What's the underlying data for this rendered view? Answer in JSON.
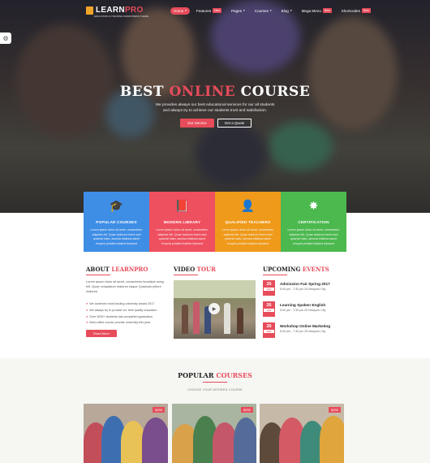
{
  "brand": {
    "name_a": "LEARN",
    "name_b": "PRO",
    "tagline": "EDUCATION & TRAINING WORDPRESS THEME"
  },
  "nav": {
    "items": [
      {
        "label": "Home",
        "badge": "",
        "active": true
      },
      {
        "label": "Features",
        "badge": "New",
        "active": false
      },
      {
        "label": "Pages",
        "badge": "",
        "active": false
      },
      {
        "label": "Courses",
        "badge": "",
        "active": false
      },
      {
        "label": "Blog",
        "badge": "",
        "active": false
      },
      {
        "label": "Mega Menu",
        "badge": "New",
        "active": false
      },
      {
        "label": "Shortcodes",
        "badge": "New",
        "active": false
      }
    ]
  },
  "hero": {
    "title_a": "BEST ",
    "title_b": "ONLINE",
    "title_c": " COURSE",
    "subtitle": "We provides always our best educational services for our all students and always try to achieve our students trust and satisfaction.",
    "btn_primary": "Our Service",
    "btn_secondary": "Get a Quote"
  },
  "features": [
    {
      "icon": "graduation-cap-icon",
      "glyph": "🎓",
      "title": "POPULAR COURSES",
      "text": "Lorem ipsum dolor sit amet, consectetur adipisici elit. Quae dolorum lorem sed quaerat iusto, accusa etaliuna saunt eluqura pinaiba bulaina lepraunt",
      "color": "#3e8ee6"
    },
    {
      "icon": "book-icon",
      "glyph": "📕",
      "title": "MODERN LIBRARY",
      "text": "Lorem ipsum dolor sit amet, consectetur adipisici elit. Quae dolorum lorem sed quaerat iusto, accusa etaliuna saunt eluqura pinaiba bulaina lepraunt",
      "color": "#ef5060"
    },
    {
      "icon": "teacher-icon",
      "glyph": "👤",
      "title": "QUALIFIED TEACHERS",
      "text": "Lorem ipsum dolor sit amet, consectetur adipisici elit. Quae dolorum lorem sed quaerat iusto, accusa etaliuna saunt eluqura pinaiba bulaina lepraunt",
      "color": "#ef9a1a"
    },
    {
      "icon": "certificate-icon",
      "glyph": "✸",
      "title": "CERTIFICATION",
      "text": "Lorem ipsum dolor sit amet, consectetur adipisici elit. Quae dolorum lorem sed quaerat iusto, accusa etaliuna saunt eluqura pinaiba bulaina lepraunt",
      "color": "#4cb94f"
    }
  ],
  "about": {
    "heading_a": "ABOUT ",
    "heading_b": "LEARNPRO",
    "text": "Lorem ipsum dolor sit amet, consectetur lunadipis scing elit. Quae voluptatum maiores eaque Quasicdo pitiore maiores.",
    "list": [
      "We achieved most leading university award 2017",
      "We always try to provide our best quality education",
      "Over 3000+ students has completed graduation",
      "Best online course provide university this year"
    ],
    "button": "Read More"
  },
  "video": {
    "heading_a": "VIDEO ",
    "heading_b": "TOUR"
  },
  "events": {
    "heading_a": "UPCOMING ",
    "heading_b": "EVENTS",
    "items": [
      {
        "day": "26",
        "month": "FEB",
        "title": "Admission Fair Spring 2017",
        "meta": "5:00 pm - 7:30 pm  25 Newyork City"
      },
      {
        "day": "26",
        "month": "FEB",
        "title": "Learning Spoken English",
        "meta": "5:00 pm - 7:30 pm  25 Newyork City"
      },
      {
        "day": "26",
        "month": "FEB",
        "title": "Workshop Online Marketing",
        "meta": "5:00 pm - 7:30 pm  25 Newyork City"
      }
    ]
  },
  "popular": {
    "heading_a": "POPULAR ",
    "heading_b": "COURSES",
    "subtitle": "CHOOSE YOUR DESIRED COURSE",
    "cards": [
      {
        "price": "$290"
      },
      {
        "price": "$290"
      },
      {
        "price": "$290"
      }
    ]
  },
  "colors": {
    "accent": "#e74c5b"
  }
}
